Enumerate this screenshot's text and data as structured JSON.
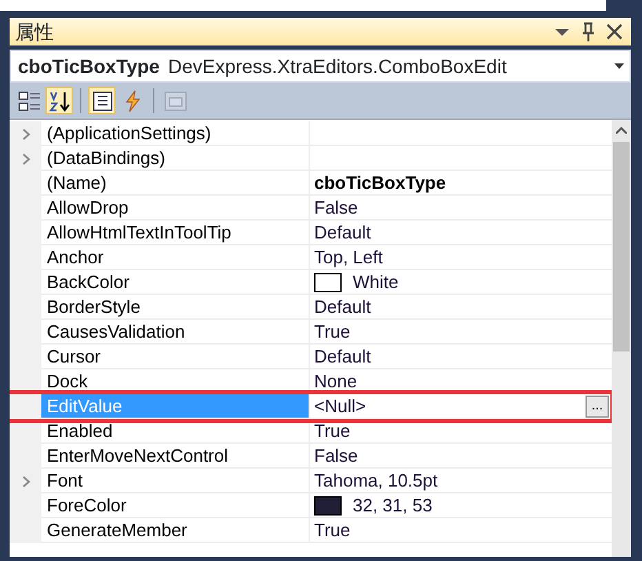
{
  "panel": {
    "title": "属性",
    "title_buttons": [
      {
        "kind": "dropdown"
      },
      {
        "kind": "pin"
      },
      {
        "kind": "close"
      }
    ]
  },
  "object_selector": {
    "name": "cboTicBoxType",
    "type": "DevExpress.XtraEditors.ComboBoxEdit"
  },
  "toolbar": [
    {
      "kind": "categorized",
      "selected": false,
      "disabled": false
    },
    {
      "kind": "alphabetical",
      "selected": true,
      "disabled": false
    },
    {
      "kind": "separator"
    },
    {
      "kind": "properties",
      "selected": true,
      "disabled": false
    },
    {
      "kind": "events",
      "selected": false,
      "disabled": false
    },
    {
      "kind": "separator"
    },
    {
      "kind": "property-pages",
      "selected": false,
      "disabled": true
    }
  ],
  "properties": [
    {
      "name": "(ApplicationSettings)",
      "expandable": true,
      "selected": false
    },
    {
      "name": "(DataBindings)",
      "expandable": true,
      "selected": false
    },
    {
      "name": "(Name)",
      "value": "cboTicBoxType",
      "bold": true,
      "expandable": false,
      "selected": false
    },
    {
      "name": "AllowDrop",
      "value": "False",
      "expandable": false,
      "selected": false
    },
    {
      "name": "AllowHtmlTextInToolTip",
      "value": "Default",
      "expandable": false,
      "selected": false
    },
    {
      "name": "Anchor",
      "value": "Top, Left",
      "expandable": false,
      "selected": false
    },
    {
      "name": "BackColor",
      "value": "White",
      "color": "#ffffff",
      "expandable": false,
      "selected": false
    },
    {
      "name": "BorderStyle",
      "value": "Default",
      "expandable": false,
      "selected": false
    },
    {
      "name": "CausesValidation",
      "value": "True",
      "expandable": false,
      "selected": false
    },
    {
      "name": "Cursor",
      "value": "Default",
      "expandable": false,
      "selected": false
    },
    {
      "name": "Dock",
      "value": "None",
      "expandable": false,
      "selected": false
    },
    {
      "name": "EditValue",
      "value": "<Null>",
      "ellipsis": "...",
      "highlighted": true,
      "expandable": false,
      "selected": true
    },
    {
      "name": "Enabled",
      "value": "True",
      "expandable": false,
      "selected": false
    },
    {
      "name": "EnterMoveNextControl",
      "value": "False",
      "expandable": false,
      "selected": false
    },
    {
      "name": "Font",
      "value": "Tahoma, 10.5pt",
      "expandable": true,
      "selected": false
    },
    {
      "name": "ForeColor",
      "value": "32, 31, 53",
      "color": "#201f35",
      "expandable": false,
      "selected": false
    },
    {
      "name": "GenerateMember",
      "value": "True",
      "expandable": false,
      "selected": false
    }
  ]
}
